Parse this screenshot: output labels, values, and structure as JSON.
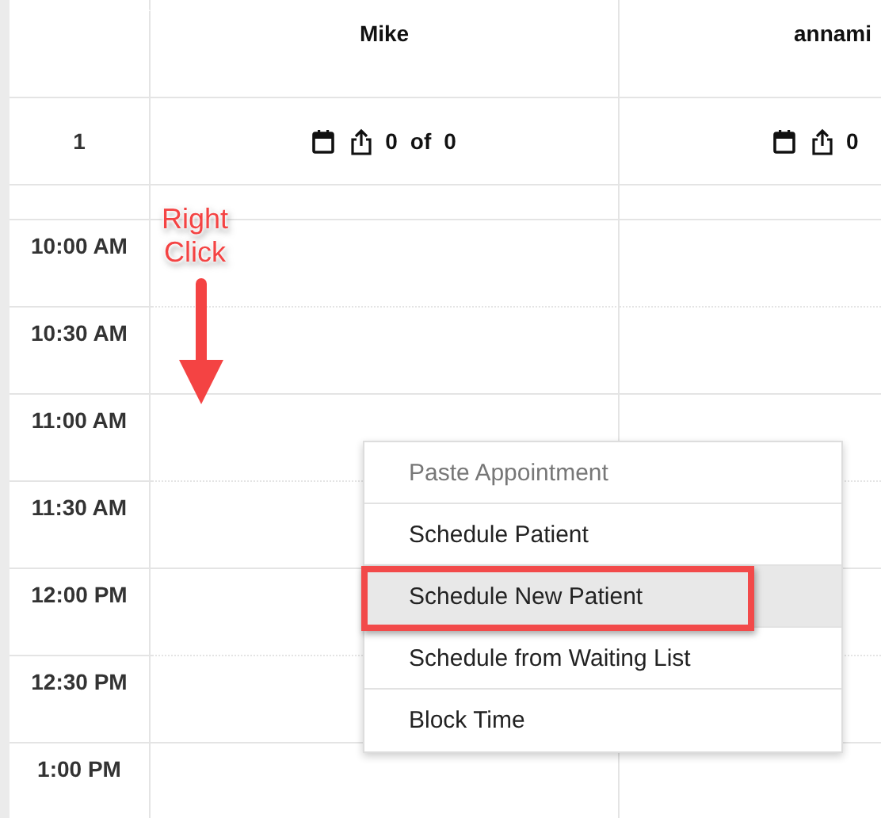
{
  "columns": [
    {
      "name": "Mike"
    },
    {
      "name": "annami"
    }
  ],
  "summary_row": {
    "label": "1",
    "cells": [
      {
        "count": "0",
        "of": "of",
        "total": "0"
      },
      {
        "count": "0"
      }
    ]
  },
  "time_slots": [
    "10:00 AM",
    "10:30 AM",
    "11:00 AM",
    "11:30 AM",
    "12:00 PM",
    "12:30 PM",
    "1:00 PM"
  ],
  "annotation": {
    "lines": [
      "Right",
      "Click"
    ]
  },
  "context_menu": [
    {
      "label": "Paste Appointment",
      "disabled": true,
      "selected": false
    },
    {
      "label": "Schedule Patient",
      "disabled": false,
      "selected": false
    },
    {
      "label": "Schedule New Patient",
      "disabled": false,
      "selected": true
    },
    {
      "label": "Schedule from Waiting List",
      "disabled": false,
      "selected": false
    },
    {
      "label": "Block Time",
      "disabled": false,
      "selected": false
    }
  ]
}
